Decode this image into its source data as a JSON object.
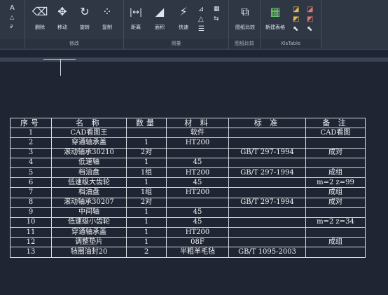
{
  "ribbon": {
    "panels": [
      {
        "label": "",
        "tools": []
      },
      {
        "label": "修改",
        "tools": [
          {
            "label": "删除",
            "icon": "eraser-icon"
          },
          {
            "label": "移动",
            "icon": "move-icon"
          },
          {
            "label": "旋转",
            "icon": "rotate-icon"
          },
          {
            "label": "复制",
            "icon": "copy-icon"
          }
        ]
      },
      {
        "label": "测量",
        "tools": [
          {
            "label": "距离",
            "icon": "distance-icon"
          },
          {
            "label": "面积",
            "icon": "area-icon"
          },
          {
            "label": "快速",
            "icon": "quick-measure-icon"
          }
        ]
      },
      {
        "label": "图纸比较",
        "tools": [
          {
            "label": "图纸比较",
            "icon": "compare-icon"
          }
        ]
      },
      {
        "label": "XlsTable",
        "tools": [
          {
            "label": "新建表格",
            "icon": "new-table-icon"
          }
        ]
      }
    ]
  },
  "table": {
    "headers": [
      "序号",
      "名  称",
      "数量",
      "材 料",
      "标  准",
      "备 注"
    ],
    "rows": [
      [
        "1",
        "CAD看图王",
        "",
        "软件",
        "",
        "CAD看图"
      ],
      [
        "2",
        "穿通轴承盖",
        "1",
        "HT200",
        "",
        ""
      ],
      [
        "3",
        "滚动轴承30210",
        "2对",
        "",
        "GB/T 297-1994",
        "成对"
      ],
      [
        "4",
        "低速轴",
        "1",
        "45",
        "",
        ""
      ],
      [
        "5",
        "档油盘",
        "1组",
        "HT200",
        "GB/T 297-1994",
        "成组"
      ],
      [
        "6",
        "低速级大齿轮",
        "1",
        "45",
        "",
        "m=2 z=99"
      ],
      [
        "7",
        "档油盘",
        "1组",
        "HT200",
        "",
        "成组"
      ],
      [
        "8",
        "滚动轴承30207",
        "2对",
        "",
        "GB/T 297-1994",
        "成对"
      ],
      [
        "9",
        "中间轴",
        "1",
        "45",
        "",
        ""
      ],
      [
        "10",
        "低速级小齿轮",
        "1",
        "45",
        "",
        "m=2 z=34"
      ],
      [
        "11",
        "穿通轴承盖",
        "1",
        "HT200",
        "",
        ""
      ],
      [
        "12",
        "调整垫片",
        "1",
        "08F",
        "",
        "成组"
      ],
      [
        "13",
        "毡圈油封20",
        "2",
        "半粗羊毛毡",
        "GB/T 1095-2003",
        ""
      ]
    ]
  }
}
